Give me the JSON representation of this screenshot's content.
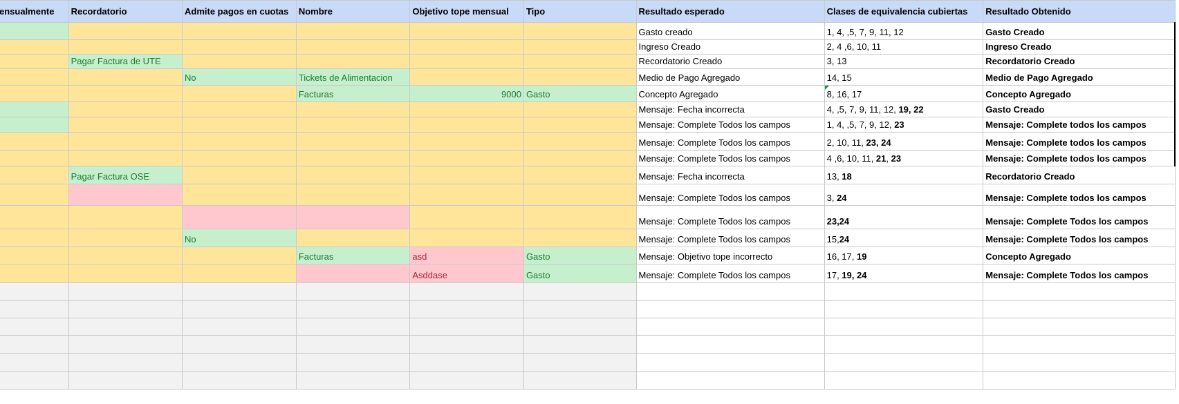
{
  "sheet": {
    "headers": [
      "ensualmente",
      "Recordatorio",
      "Admite pagos en cuotas",
      "Nombre",
      "Objetivo tope mensual",
      "Tipo",
      "Resultado esperado",
      "Clases de equivalencia cubiertas",
      "Resultado Obtenido"
    ],
    "rows": [
      {
        "h": 25,
        "cells": [
          {
            "c": "g"
          },
          {
            "c": "y"
          },
          {
            "c": "y"
          },
          {
            "c": "y"
          },
          {
            "c": "y"
          },
          {
            "c": "y"
          },
          {
            "c": "w",
            "segs": [
              {
                "t": "Gasto creado"
              }
            ]
          },
          {
            "c": "w",
            "segs": [
              {
                "t": "1, 4, ,5, 7, 9, 11, 12"
              }
            ]
          },
          {
            "c": "w edge",
            "segs": [
              {
                "t": "Gasto Creado",
                "b": 1
              }
            ]
          }
        ]
      },
      {
        "h": 21,
        "cells": [
          {
            "c": "y"
          },
          {
            "c": "y"
          },
          {
            "c": "y"
          },
          {
            "c": "y"
          },
          {
            "c": "y"
          },
          {
            "c": "y"
          },
          {
            "c": "w",
            "segs": [
              {
                "t": "Ingreso Creado"
              }
            ]
          },
          {
            "c": "w",
            "segs": [
              {
                "t": "2, 4 ,6, 10, 11"
              }
            ]
          },
          {
            "c": "w edge",
            "segs": [
              {
                "t": "Ingreso Creado",
                "b": 1
              }
            ]
          }
        ]
      },
      {
        "h": 21,
        "cells": [
          {
            "c": "y"
          },
          {
            "c": "g",
            "segs": [
              {
                "t": "Pagar Factura de UTE"
              }
            ]
          },
          {
            "c": "y"
          },
          {
            "c": "y"
          },
          {
            "c": "y"
          },
          {
            "c": "y"
          },
          {
            "c": "w",
            "segs": [
              {
                "t": "Recordatorio Creado"
              }
            ]
          },
          {
            "c": "w",
            "segs": [
              {
                "t": "3, 13"
              }
            ]
          },
          {
            "c": "w edge",
            "segs": [
              {
                "t": "Recordatorio Creado",
                "b": 1
              }
            ]
          }
        ]
      },
      {
        "h": 24,
        "cells": [
          {
            "c": "y"
          },
          {
            "c": "y"
          },
          {
            "c": "g",
            "segs": [
              {
                "t": "No"
              }
            ]
          },
          {
            "c": "g",
            "segs": [
              {
                "t": "Tickets de Alimentacion"
              }
            ]
          },
          {
            "c": "y"
          },
          {
            "c": "y"
          },
          {
            "c": "w",
            "segs": [
              {
                "t": "Medio de Pago Agregado"
              }
            ]
          },
          {
            "c": "w",
            "segs": [
              {
                "t": "14, 15"
              }
            ]
          },
          {
            "c": "w edge",
            "segs": [
              {
                "t": "Medio de Pago Agregado",
                "b": 1
              }
            ]
          }
        ]
      },
      {
        "h": 24,
        "cells": [
          {
            "c": "y"
          },
          {
            "c": "y"
          },
          {
            "c": "y"
          },
          {
            "c": "g",
            "segs": [
              {
                "t": "Facturas"
              }
            ]
          },
          {
            "c": "g num",
            "segs": [
              {
                "t": "9000"
              }
            ]
          },
          {
            "c": "g",
            "segs": [
              {
                "t": "Gasto"
              }
            ]
          },
          {
            "c": "w",
            "segs": [
              {
                "t": "Concepto Agregado"
              }
            ]
          },
          {
            "c": "w flag",
            "segs": [
              {
                "t": "8, 16, 17"
              }
            ]
          },
          {
            "c": "w edge",
            "segs": [
              {
                "t": "Concepto Agregado",
                "b": 1
              }
            ]
          }
        ]
      },
      {
        "h": 22,
        "cells": [
          {
            "c": "g"
          },
          {
            "c": "y"
          },
          {
            "c": "y"
          },
          {
            "c": "y"
          },
          {
            "c": "y"
          },
          {
            "c": "y"
          },
          {
            "c": "w",
            "segs": [
              {
                "t": "Mensaje: Fecha incorrecta"
              }
            ]
          },
          {
            "c": "w",
            "segs": [
              {
                "t": "4, ,5, 7, 9, 11, 12, "
              },
              {
                "t": "19, 22",
                "b": 1
              }
            ]
          },
          {
            "c": "w edge",
            "segs": [
              {
                "t": "Gasto Creado",
                "b": 1
              }
            ]
          }
        ]
      },
      {
        "h": 22,
        "cells": [
          {
            "c": "g"
          },
          {
            "c": "y"
          },
          {
            "c": "y"
          },
          {
            "c": "y"
          },
          {
            "c": "y"
          },
          {
            "c": "y"
          },
          {
            "c": "w",
            "segs": [
              {
                "t": "Mensaje: Complete Todos los campos"
              }
            ]
          },
          {
            "c": "w",
            "segs": [
              {
                "t": "1, 4, ,5, 7, 9, 12, "
              },
              {
                "t": "23",
                "b": 1
              }
            ]
          },
          {
            "c": "w edge",
            "segs": [
              {
                "t": "Mensaje: Complete todos los campos",
                "b": 1
              }
            ]
          }
        ]
      },
      {
        "h": 26,
        "cells": [
          {
            "c": "y"
          },
          {
            "c": "y"
          },
          {
            "c": "y"
          },
          {
            "c": "y"
          },
          {
            "c": "y"
          },
          {
            "c": "y"
          },
          {
            "c": "w",
            "segs": [
              {
                "t": "Mensaje: Complete Todos los campos"
              }
            ]
          },
          {
            "c": "w",
            "segs": [
              {
                "t": "2, 10, 11, "
              },
              {
                "t": "23, 24",
                "b": 1
              }
            ]
          },
          {
            "c": "w edge",
            "segs": [
              {
                "t": "Mensaje: Complete todos los campos",
                "b": 1
              }
            ]
          }
        ]
      },
      {
        "h": 23,
        "cells": [
          {
            "c": "y"
          },
          {
            "c": "y"
          },
          {
            "c": "y"
          },
          {
            "c": "y"
          },
          {
            "c": "y"
          },
          {
            "c": "y"
          },
          {
            "c": "w",
            "segs": [
              {
                "t": "Mensaje: Complete Todos los campos"
              }
            ]
          },
          {
            "c": "w",
            "segs": [
              {
                "t": " 4 ,6, 10, 11, "
              },
              {
                "t": "21",
                "b": 1
              },
              {
                "t": ", "
              },
              {
                "t": "23",
                "b": 1
              }
            ]
          },
          {
            "c": "w edge",
            "segs": [
              {
                "t": "Mensaje: Complete todos los campos",
                "b": 1
              }
            ]
          }
        ]
      },
      {
        "h": 26,
        "cells": [
          {
            "c": "y"
          },
          {
            "c": "g",
            "segs": [
              {
                "t": "Pagar Factura OSE"
              }
            ]
          },
          {
            "c": "y"
          },
          {
            "c": "y"
          },
          {
            "c": "y"
          },
          {
            "c": "y"
          },
          {
            "c": "w",
            "segs": [
              {
                "t": "Mensaje: Fecha incorrecta"
              }
            ]
          },
          {
            "c": "w",
            "segs": [
              {
                "t": "13, "
              },
              {
                "t": "18",
                "b": 1
              }
            ]
          },
          {
            "c": "w",
            "segs": [
              {
                "t": "Recordatorio Creado",
                "b": 1
              }
            ]
          }
        ]
      },
      {
        "h": 31,
        "cells": [
          {
            "c": "y"
          },
          {
            "c": "p"
          },
          {
            "c": "y"
          },
          {
            "c": "y"
          },
          {
            "c": "y"
          },
          {
            "c": "y"
          },
          {
            "c": "w",
            "segs": [
              {
                "t": "Mensaje:  Complete Todos los campos"
              }
            ]
          },
          {
            "c": "w",
            "segs": [
              {
                "t": "3, "
              },
              {
                "t": "24",
                "b": 1
              }
            ]
          },
          {
            "c": "w",
            "segs": [
              {
                "t": "Mensaje: Complete todos los campos",
                "b": 1
              }
            ]
          }
        ]
      },
      {
        "h": 34,
        "cells": [
          {
            "c": "y"
          },
          {
            "c": "y"
          },
          {
            "c": "p"
          },
          {
            "c": "p"
          },
          {
            "c": "y"
          },
          {
            "c": "y"
          },
          {
            "c": "w",
            "segs": [
              {
                "t": "Mensaje:  Complete Todos los campos"
              }
            ]
          },
          {
            "c": "w",
            "segs": [
              {
                "t": "23,24",
                "b": 1
              }
            ]
          },
          {
            "c": "w",
            "segs": [
              {
                "t": "Mensaje:  Complete Todos los campos",
                "b": 1
              }
            ]
          }
        ]
      },
      {
        "h": 26,
        "cells": [
          {
            "c": "y"
          },
          {
            "c": "y"
          },
          {
            "c": "g",
            "segs": [
              {
                "t": "No"
              }
            ]
          },
          {
            "c": "y"
          },
          {
            "c": "y"
          },
          {
            "c": "y"
          },
          {
            "c": "w",
            "segs": [
              {
                "t": "Mensaje:  Complete Todos los campos"
              }
            ]
          },
          {
            "c": "w",
            "segs": [
              {
                "t": "15,"
              },
              {
                "t": "24",
                "b": 1
              }
            ]
          },
          {
            "c": "w",
            "segs": [
              {
                "t": "Mensaje:  Complete Todos los campos",
                "b": 1
              }
            ]
          }
        ]
      },
      {
        "h": 25,
        "cells": [
          {
            "c": "y"
          },
          {
            "c": "y"
          },
          {
            "c": "y"
          },
          {
            "c": "g",
            "segs": [
              {
                "t": "Facturas"
              }
            ]
          },
          {
            "c": "p",
            "segs": [
              {
                "t": "asd"
              }
            ]
          },
          {
            "c": "g",
            "segs": [
              {
                "t": "Gasto"
              }
            ]
          },
          {
            "c": "w",
            "segs": [
              {
                "t": "Mensaje: Objetivo tope incorrecto"
              }
            ]
          },
          {
            "c": "w",
            "segs": [
              {
                "t": "16, 17, "
              },
              {
                "t": "19",
                "b": 1
              }
            ]
          },
          {
            "c": "w",
            "segs": [
              {
                "t": "Concepto Agregado",
                "b": 1
              }
            ]
          }
        ]
      },
      {
        "h": 27,
        "cells": [
          {
            "c": "y"
          },
          {
            "c": "y"
          },
          {
            "c": "y"
          },
          {
            "c": "p"
          },
          {
            "c": "p",
            "segs": [
              {
                "t": "Asddase"
              }
            ]
          },
          {
            "c": "g",
            "segs": [
              {
                "t": "Gasto"
              }
            ]
          },
          {
            "c": "w",
            "segs": [
              {
                "t": "Mensaje:  Complete Todos los campos"
              }
            ]
          },
          {
            "c": "w",
            "segs": [
              {
                "t": "17, "
              },
              {
                "t": "19, 24",
                "b": 1
              }
            ]
          },
          {
            "c": "w",
            "segs": [
              {
                "t": "Mensaje:  Complete Todos los campos",
                "b": 1
              }
            ]
          }
        ]
      },
      {
        "h": 26,
        "empty": true
      },
      {
        "h": 25,
        "empty": true
      },
      {
        "h": 25,
        "empty": true
      },
      {
        "h": 26,
        "empty": true
      },
      {
        "h": 26,
        "empty": true
      },
      {
        "h": 26,
        "empty": true
      }
    ]
  }
}
